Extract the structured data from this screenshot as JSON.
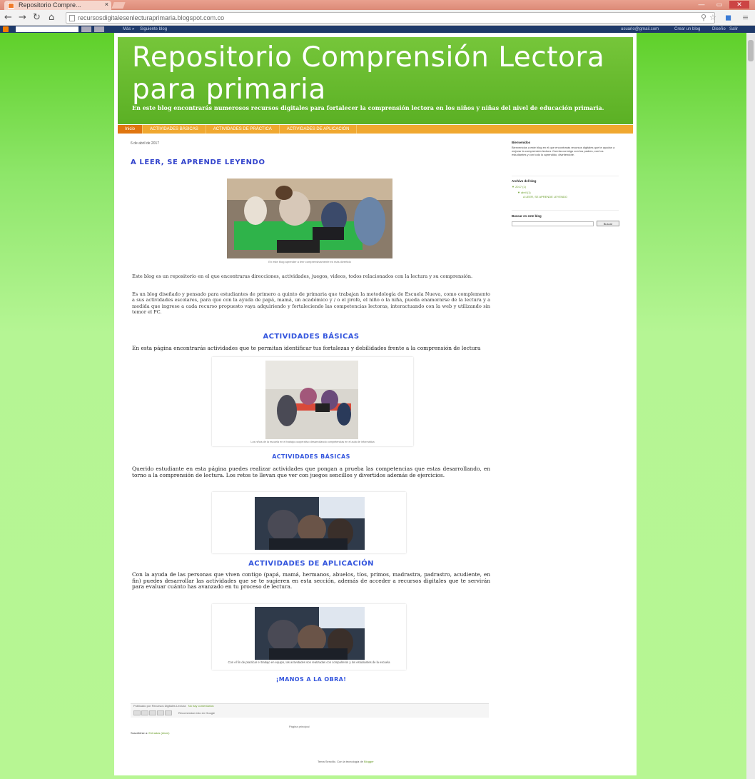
{
  "browser": {
    "tab_title": "Repositorio Compre...",
    "tab_close": "×",
    "url": "recursosdigitalesenlecturaprimaria.blogspot.com.co",
    "window_controls": [
      "—",
      "▭",
      "✕"
    ]
  },
  "navbar": {
    "links": [
      "Más »",
      "Siguiente blog"
    ],
    "right_links": [
      "usuario@gmail.com",
      "Crear un blog",
      "Diseño",
      "Salir"
    ]
  },
  "header": {
    "title": "Repositorio Comprensión Lectora para primaria",
    "description": "En este blog encontrarás numerosos recursos digitales para fortalecer la comprensión lectora en los niños y niñas del nivel de educación primaria."
  },
  "tabs": [
    "Inicio",
    "ACTIVIDADES BÁSICAS",
    "ACTIVIDADES DE PRÁCTICA",
    "ACTIVIDADES DE APLICACIÓN"
  ],
  "post": {
    "date": "6 de abril de 2017",
    "title": "A LEER, SE APRENDE LEYENDO",
    "caption1": "En este blog aprender a leer comprensivamente es más divertido",
    "para1": "Este blog es un repositorio en el que encontraras direcciones, actividades, juegos, videos, todos relacionados con la lectura y su comprensión.",
    "para2": "Es un blog diseñado y pensado para estudiantes de primero a quinto de primaria que trabajan la metodología de Escuela Nueva, como complemento a sus actividades escolares, para que con la ayuda de papá, mamá, un académico y / o el profe, el niño o la niña, pueda enamorarse de la lectura y a medida que ingrese a cada recurso propuesto vaya adquiriendo y fortaleciendo las competencias lectoras, interactuando con la web y utilizando sin temor el PC.",
    "section1_title": "ACTIVIDADES BÁSICAS",
    "section1_text": "En esta página encontrarás actividades que te permitan identificar tus fortalezas y debilidades frente a la comprensión de lectura",
    "caption2": "Los niños de la escuela en el trabajo cooperativo desarrollando competencias en el aula de informática",
    "section2_title": "ACTIVIDADES BÁSICAS",
    "section2_text": "Querido estudiante en esta página puedes realizar actividades que pongan a prueba las competencias que estas desarrollando, en torno a la comprensión de lectura. Los retos te llevan que ver con juegos sencillos y divertidos además de ejercicios.",
    "section3_title": "ACTIVIDADES DE APLICACIÓN",
    "section3_text": "Con la ayuda de las personas que viven contigo (papá, mamá, hermanos, abuelos, tíos, primos, madrastra, padrastro, acudiente, en fin) puedes desarrollar las actividades que se te sugieren en esta sección, además de acceder a recursos digitales que te servirán para evaluar cuánto has avanzado en tu proceso de lectura.",
    "caption4": "Con el fin de practicar el trabajo en equipo, las actividades son realizadas con compañeros y los estudiantes de la escuela",
    "section4_title": "¡MANOS A LA OBRA!",
    "footer_posted": "Publicado por Recursos Digitales Lectura",
    "footer_link": "No hay comentarios:",
    "share_text": "Recomendar esto en Google",
    "home_link": "Página principal",
    "subscribe_label": "Suscribirse a:",
    "subscribe_link": "Entradas (Atom)",
    "powered_text": "Tema Sencillo. Con la tecnología de",
    "powered_link": "Blogger"
  },
  "sidebar": {
    "about_heading": "Bienvenidos",
    "about_text": "Bienvenidos a este blog en el que encontrarás recursos digitales que te ayudan a mejorar la comprensión lectora. Cuenta conmigo con tus padres, con los estudiantes y con todo lo aprendido, divirtiéndote.",
    "archive_heading": "Archivo del blog",
    "archive_year": "▼ 2017 (1)",
    "archive_month": "▼ abril (1)",
    "archive_post": "A LEER, SE APRENDE LEYENDO",
    "search_heading": "Buscar en este blog",
    "search_button": "Buscar"
  },
  "colors": {
    "header_green": "#5bb024",
    "tab_orange": "#f0a830",
    "title_blue": "#3344cc",
    "link_green": "#6a9d2a"
  }
}
